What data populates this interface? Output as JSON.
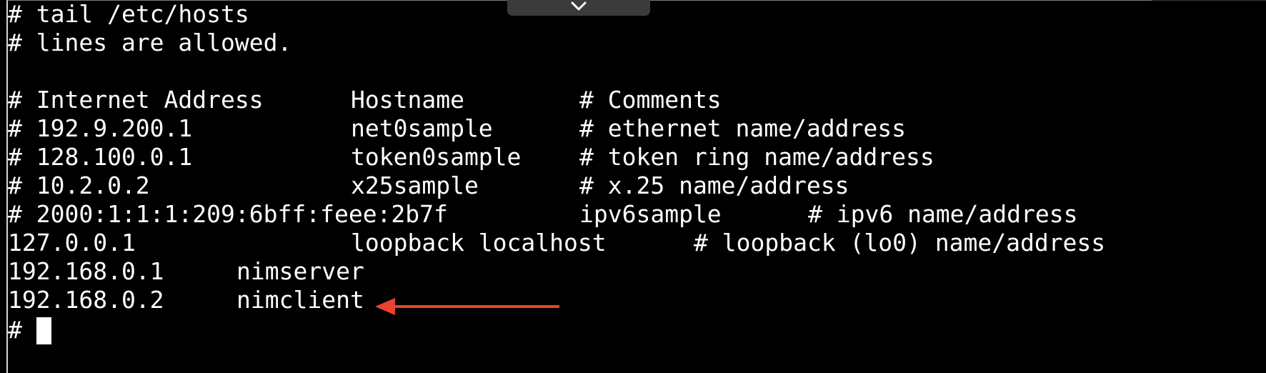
{
  "terminal": {
    "prompt": "#",
    "lines": [
      {
        "text": "# tail /etc/hosts"
      },
      {
        "text": "# lines are allowed."
      },
      {
        "text": ""
      },
      {
        "c1": "# Internet Address",
        "c2": "Hostname",
        "c3": "# Comments"
      },
      {
        "c1": "# 192.9.200.1",
        "c2": "net0sample",
        "c3": "# ethernet name/address"
      },
      {
        "c1": "# 128.100.0.1",
        "c2": "token0sample",
        "c3": "# token ring name/address"
      },
      {
        "c1": "# 10.2.0.2",
        "c2": "x25sample",
        "c3": "# x.25 name/address"
      },
      {
        "c1": "# 2000:1:1:1:209:6bff:feee:2b7f",
        "c2": "ipv6sample",
        "c3": "# ipv6 name/address"
      },
      {
        "c1": "127.0.0.1",
        "c2": "loopback localhost",
        "c3": "# loopback (lo0) name/address"
      },
      {
        "c1": "192.168.0.1",
        "c2": "nimserver"
      },
      {
        "c1": "192.168.0.2",
        "c2": "nimclient"
      }
    ]
  },
  "colors": {
    "background": "#000000",
    "text": "#ffffff",
    "annotation_arrow": "#e8432f",
    "handle": "#3b3b3b"
  },
  "icons": {
    "toolbar_handle": "chevron-down-icon",
    "annotation": "arrow-left-icon"
  }
}
